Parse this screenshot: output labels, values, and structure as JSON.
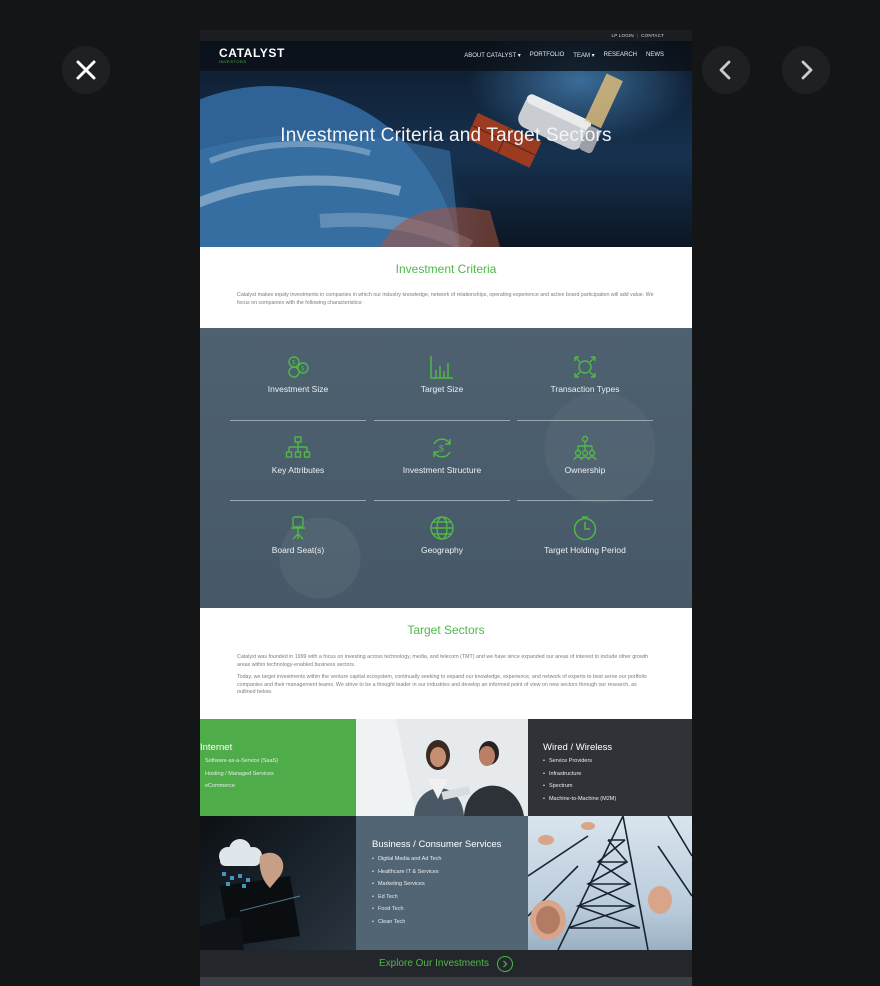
{
  "viewer": {
    "close_icon": "close-icon",
    "prev_icon": "chevron-left-icon",
    "next_icon": "chevron-right-icon"
  },
  "utility_bar": {
    "lp_login": "LP LOGIN",
    "separator": "|",
    "contact": "CONTACT"
  },
  "header": {
    "logo": "CATALYST",
    "logo_sub": "INVESTORS",
    "nav": [
      "ABOUT CATALYST ▾",
      "PORTFOLIO",
      "TEAM ▾",
      "RESEARCH",
      "NEWS"
    ]
  },
  "hero": {
    "title": "Investment Criteria and Target Sectors"
  },
  "criteria": {
    "title": "Investment Criteria",
    "intro": "Catalyst makes equity investments in companies in which our industry knowledge, network of relationships, operating experience and active board participation will add value. We focus on companies with the following characteristics:",
    "items": [
      {
        "label": "Investment Size",
        "icon": "coins-icon"
      },
      {
        "label": "Target Size",
        "icon": "bar-chart-icon"
      },
      {
        "label": "Transaction Types",
        "icon": "exchange-icon"
      },
      {
        "label": "Key Attributes",
        "icon": "org-chart-icon"
      },
      {
        "label": "Investment Structure",
        "icon": "dollar-cycle-icon"
      },
      {
        "label": "Ownership",
        "icon": "hierarchy-icon"
      },
      {
        "label": "Board Seat(s)",
        "icon": "chair-icon"
      },
      {
        "label": "Geography",
        "icon": "globe-icon"
      },
      {
        "label": "Target Holding Period",
        "icon": "clock-icon"
      }
    ]
  },
  "sectors": {
    "title": "Target Sectors",
    "intro_1": "Catalyst was founded in 1999 with a focus on investing across technology, media, and telecom (TMT) and we have since expanded our areas of interest to include other growth areas within technology-enabled business sectors.",
    "intro_2": "Today, we target investments within the venture capital ecosystem, continually seeking to expand our knowledge, experience, and network of experts to best serve our portfolio companies and their management teams. We strive to be a thought leader in our industries and develop an informed point of view on new sectors through our research, as outlined below.",
    "internet": {
      "title": "Internet",
      "items": [
        "Software-as-a-Service (SaaS)",
        "Hosting / Managed Services",
        "eCommerce"
      ]
    },
    "wired": {
      "title": "Wired / Wireless",
      "items": [
        "Service Providers",
        "Infrastructure",
        "Spectrum",
        "Machine-to-Machine (M2M)"
      ]
    },
    "business": {
      "title": "Business / Consumer Services",
      "items": [
        "Digital Media and Ad Tech",
        "Healthcare IT & Services",
        "Marketing Services",
        "Ed Tech",
        "Food Tech",
        "Clean Tech"
      ]
    }
  },
  "explore": {
    "label": "Explore Our Investments",
    "icon": "chevron-circle-right-icon"
  }
}
